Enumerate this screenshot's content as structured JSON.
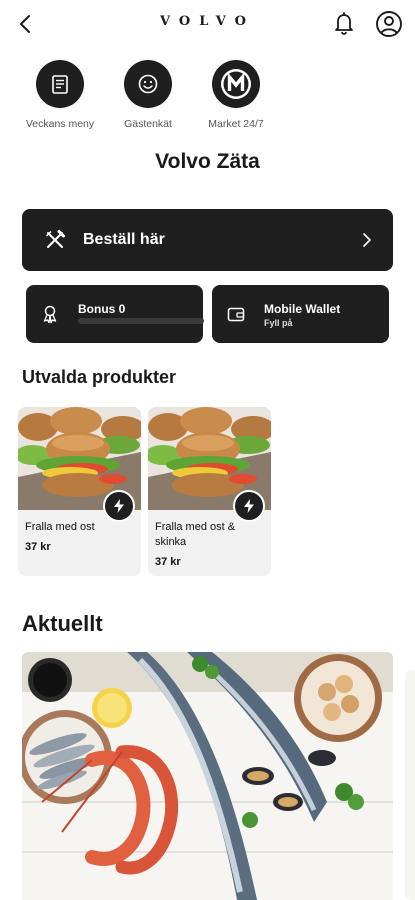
{
  "header": {
    "brand": "VOLVO"
  },
  "shortcuts": [
    {
      "label": "Veckans meny",
      "icon": "menu-card-icon"
    },
    {
      "label": "Gästenkät",
      "icon": "smiley-icon"
    },
    {
      "label": "Market 24/7",
      "icon": "market-m-icon"
    }
  ],
  "site": {
    "title": "Volvo Zäta"
  },
  "order": {
    "label": "Beställ här"
  },
  "bonus": {
    "label": "Bonus 0"
  },
  "wallet": {
    "label": "Mobile Wallet",
    "sub": "Fyll på"
  },
  "featured": {
    "title": "Utvalda produkter",
    "products": [
      {
        "name": "Fralla med ost",
        "price": "37 kr"
      },
      {
        "name": "Fralla med ost & skinka",
        "price": "37 kr"
      }
    ]
  },
  "news": {
    "title": "Aktuellt"
  },
  "colors": {
    "dark": "#1f1f1f",
    "card_bg": "#f1f1f1"
  }
}
